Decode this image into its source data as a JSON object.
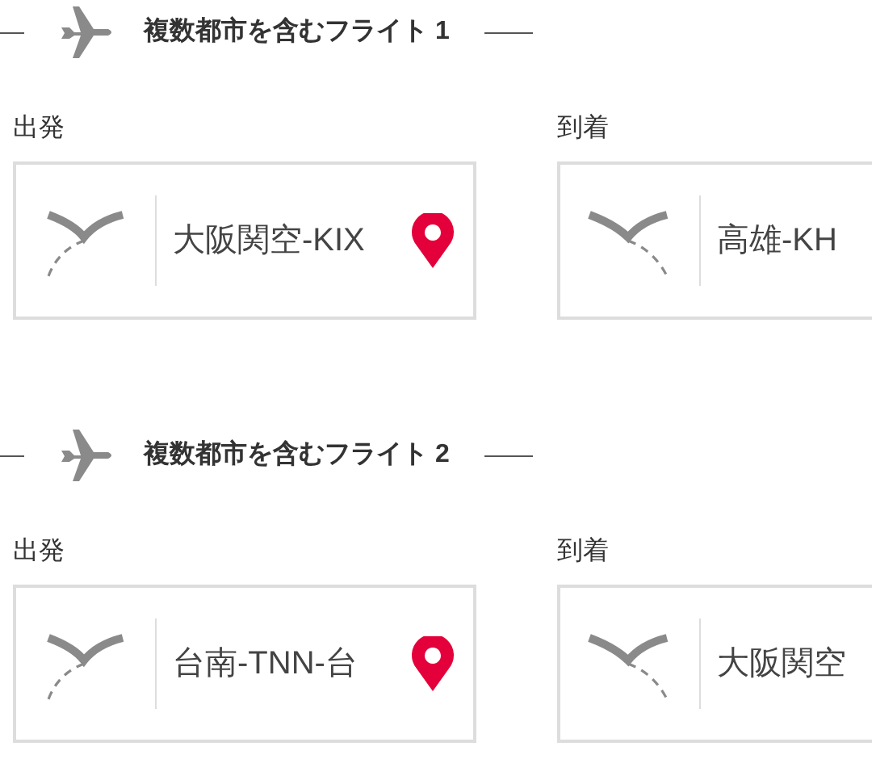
{
  "flights": [
    {
      "title": "複数都市を含むフライト 1",
      "fields": [
        {
          "kind": "departure",
          "label": "出発",
          "value": "大阪関空-KIX",
          "pin": true
        },
        {
          "kind": "arrival",
          "label": "到着",
          "value": "高雄-KH"
        }
      ]
    },
    {
      "title": "複数都市を含むフライト 2",
      "fields": [
        {
          "kind": "departure",
          "label": "出発",
          "value": "台南-TNN-台",
          "pin": true
        },
        {
          "kind": "arrival",
          "label": "到着",
          "value": "大阪関空"
        }
      ]
    }
  ]
}
